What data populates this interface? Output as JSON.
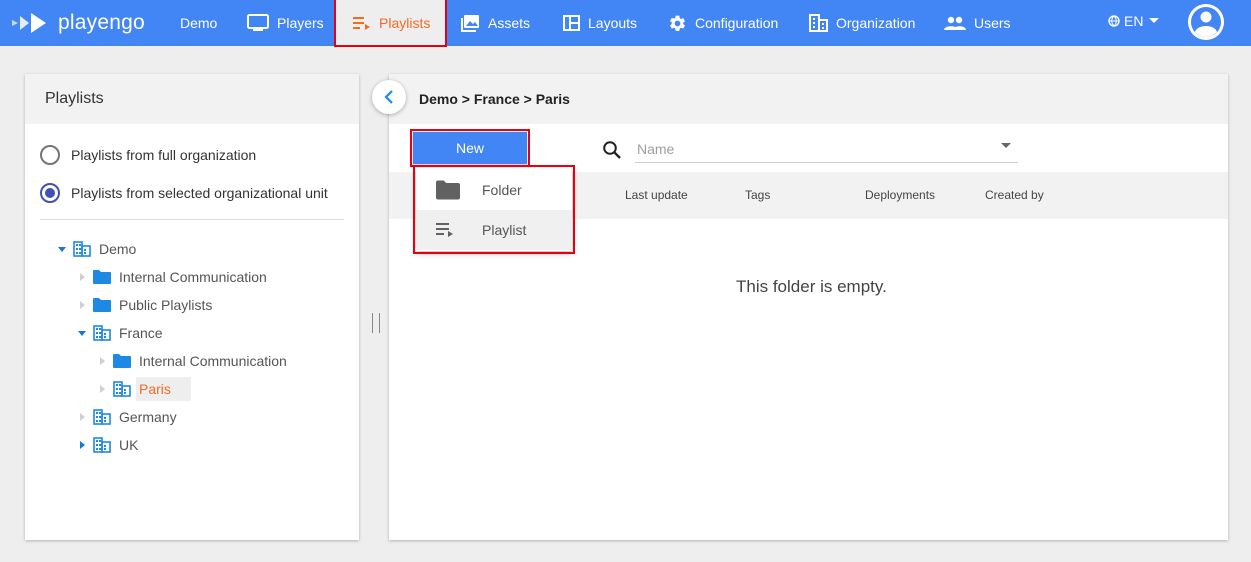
{
  "app": {
    "logo_text": "playengo"
  },
  "nav": {
    "items": [
      {
        "label": "Demo",
        "icon": "none"
      },
      {
        "label": "Players",
        "icon": "monitor-icon"
      },
      {
        "label": "Playlists",
        "icon": "playlist-icon",
        "active": true
      },
      {
        "label": "Assets",
        "icon": "image-icon"
      },
      {
        "label": "Layouts",
        "icon": "layout-icon"
      },
      {
        "label": "Configuration",
        "icon": "gear-icon"
      },
      {
        "label": "Organization",
        "icon": "building-icon"
      },
      {
        "label": "Users",
        "icon": "users-icon"
      }
    ],
    "language": "EN"
  },
  "left_panel": {
    "title": "Playlists",
    "radio_full_org": "Playlists from full organization",
    "radio_selected_unit": "Playlists from selected organizational unit",
    "tree": [
      {
        "label": "Demo",
        "type": "org",
        "expanded": true
      },
      {
        "label": "Internal Communication",
        "type": "folder"
      },
      {
        "label": "Public Playlists",
        "type": "folder"
      },
      {
        "label": "France",
        "type": "org",
        "expanded": true
      },
      {
        "label": "Internal Communication",
        "type": "folder"
      },
      {
        "label": "Paris",
        "type": "org",
        "selected": true
      },
      {
        "label": "Germany",
        "type": "org"
      },
      {
        "label": "UK",
        "type": "org"
      }
    ]
  },
  "right_panel": {
    "breadcrumb": "Demo > France > Paris",
    "new_button": "New",
    "search_placeholder": "Name",
    "columns": [
      "Last update",
      "Tags",
      "Deployments",
      "Created by"
    ],
    "empty_message": "This folder is empty.",
    "new_menu": [
      {
        "label": "Folder",
        "icon": "folder-icon"
      },
      {
        "label": "Playlist",
        "icon": "playlist-icon"
      }
    ]
  },
  "colors": {
    "nav_bg": "#4285f4",
    "accent": "#f26b21",
    "highlight": "#e60012",
    "radio": "#3f51b5"
  }
}
